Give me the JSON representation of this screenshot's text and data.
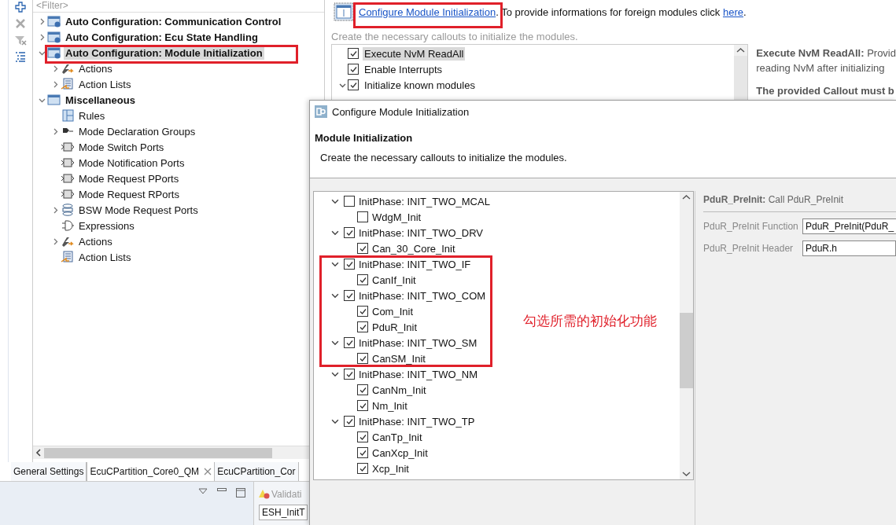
{
  "tree": {
    "filter_placeholder": "<Filter>",
    "items": [
      {
        "label": "Auto Configuration: Communication Control",
        "kind": "auto-config",
        "expanded": false,
        "selected": false
      },
      {
        "label": "Auto Configuration: Ecu State Handling",
        "kind": "auto-config",
        "expanded": false,
        "selected": false
      },
      {
        "label": "Auto Configuration: Module Initialization",
        "kind": "auto-config",
        "expanded": true,
        "selected": true,
        "children": [
          {
            "label": "Actions",
            "kind": "actions",
            "expanded": false,
            "selected": false
          },
          {
            "label": "Action Lists",
            "kind": "action-list",
            "expanded": false,
            "selected": false
          }
        ]
      },
      {
        "label": "Miscellaneous",
        "kind": "folder",
        "expanded": true,
        "selected": false,
        "children": [
          {
            "label": "Rules",
            "kind": "rules",
            "selected": false
          },
          {
            "label": "Mode Declaration Groups",
            "kind": "mode-group",
            "expanded": false,
            "selected": false
          },
          {
            "label": "Mode Switch Ports",
            "kind": "mode-switch",
            "selected": false
          },
          {
            "label": "Mode Notification Ports",
            "kind": "mode-notify",
            "selected": false
          },
          {
            "label": "Mode Request PPorts",
            "kind": "mode-pport",
            "selected": false
          },
          {
            "label": "Mode Request RPorts",
            "kind": "mode-rport",
            "selected": false
          },
          {
            "label": "BSW Mode Request Ports",
            "kind": "bsw-port",
            "expanded": false,
            "selected": false
          },
          {
            "label": "Expressions",
            "kind": "expression",
            "selected": false
          },
          {
            "label": "Actions",
            "kind": "actions",
            "expanded": false,
            "selected": false
          },
          {
            "label": "Action Lists",
            "kind": "action-list",
            "selected": false
          }
        ]
      }
    ]
  },
  "tabs": [
    {
      "label": "General Settings",
      "selected": false
    },
    {
      "label": "EcuCPartition_Core0_QM",
      "selected": true
    },
    {
      "label": "EcuCPartition_Cor",
      "selected": false
    }
  ],
  "editor": {
    "link": "Configure Module Initialization",
    "middle": ". To provide informations for foreign modules click ",
    "here_link": "here",
    "end": ".",
    "subtitle": "Create the necessary callouts to initialize the modules.",
    "options": [
      {
        "label": "Execute NvM ReadAll",
        "checked": true,
        "selected": true
      },
      {
        "label": "Enable Interrupts",
        "checked": true,
        "selected": false
      },
      {
        "label": "Initialize known modules",
        "checked": true,
        "selected": false,
        "expanded": true
      }
    ],
    "description": {
      "title": "Execute NvM ReadAll:",
      "text": "Provid",
      "line2": "reading NvM after initializing",
      "line3": "The provided Callout must b"
    }
  },
  "bottom": {
    "validation_tab": "Validati",
    "field_value": "ESH_InitT"
  },
  "dialog": {
    "title": "Configure Module Initialization",
    "heading": "Module Initialization",
    "description": "Create the necessary callouts to initialize the modules.",
    "phases": [
      {
        "label": "InitPhase: INIT_TWO_MCAL",
        "checked": false,
        "expanded": true,
        "children": [
          {
            "label": "WdgM_Init",
            "checked": false
          }
        ]
      },
      {
        "label": "InitPhase: INIT_TWO_DRV",
        "checked": true,
        "expanded": true,
        "children": [
          {
            "label": "Can_30_Core_Init",
            "checked": true
          }
        ]
      },
      {
        "label": "InitPhase: INIT_TWO_IF",
        "checked": true,
        "expanded": true,
        "children": [
          {
            "label": "CanIf_Init",
            "checked": true
          }
        ]
      },
      {
        "label": "InitPhase: INIT_TWO_COM",
        "checked": true,
        "expanded": true,
        "children": [
          {
            "label": "Com_Init",
            "checked": true
          },
          {
            "label": "PduR_Init",
            "checked": true
          }
        ]
      },
      {
        "label": "InitPhase: INIT_TWO_SM",
        "checked": true,
        "expanded": true,
        "children": [
          {
            "label": "CanSM_Init",
            "checked": true
          }
        ]
      },
      {
        "label": "InitPhase: INIT_TWO_NM",
        "checked": true,
        "expanded": true,
        "children": [
          {
            "label": "CanNm_Init",
            "checked": true
          },
          {
            "label": "Nm_Init",
            "checked": true
          }
        ]
      },
      {
        "label": "InitPhase: INIT_TWO_TP",
        "checked": true,
        "expanded": true,
        "children": [
          {
            "label": "CanTp_Init",
            "checked": true
          },
          {
            "label": "CanXcp_Init",
            "checked": true
          },
          {
            "label": "Xcp_Init",
            "checked": true
          }
        ]
      }
    ],
    "detail": {
      "title": "PduR_PreInit:",
      "text": "Call PduR_PreInit",
      "fields": [
        {
          "label": "PduR_PreInit Function",
          "value": "PduR_PreInit(PduR_"
        },
        {
          "label": "PduR_PreInit Header",
          "value": "PduR.h"
        }
      ]
    }
  },
  "annotation": {
    "note": "勾选所需的初始化功能"
  }
}
